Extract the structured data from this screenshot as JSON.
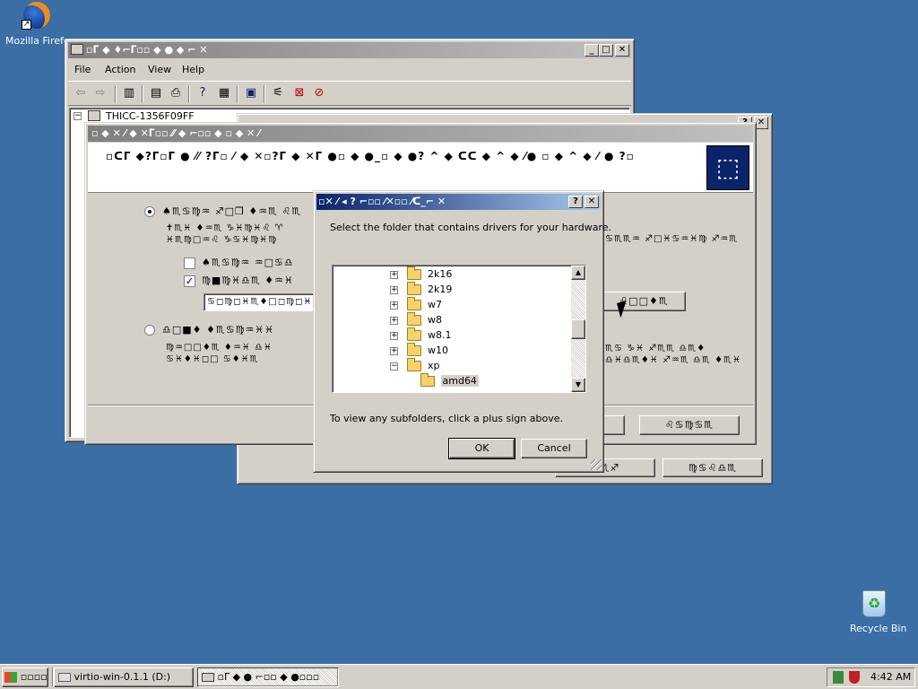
{
  "desktop": {
    "firefox_label": "Mozilla Firefox",
    "recycle_label": "Recycle Bin"
  },
  "device_manager": {
    "title": "▫ᒥ ◆ ♦⌐ᒥ▫▫ ◆ ● ◆ ⌐ ✕",
    "menu": [
      "File",
      "Action",
      "View",
      "Help"
    ],
    "tree_root": "THICC-1356F09FF"
  },
  "wizard": {
    "title": "▫ ◆ ✕ ⁄ ◆ ✕ᒥ▫▫ ⁄⁄ ◆ ⌐▫▫ ◆ ▫ ◆ ✕ ⁄",
    "header_text": "▫ᑕᒥ ◆?ᒥ▫ᒥ ● ⁄⁄ ?ᒥ▫ ⁄ ◆ ✕▫?ᒥ ◆ ✕ᒥ ●▫ ◆ ●_▫ ◆ ●? ^ ◆ ᑕᑕ ◆ ^ ◆ ⁄● ▫ ◆ ^ ◆ ⁄ ● ?▫",
    "option1_label": "♠♏♋♍♒ ♐□❒ ♦♒♏ ♌♏",
    "option1_desc1": "✝♏♓ ♦♒♏ ♑♓♍♓♌ ♈",
    "option1_desc2": "♓♏♍□♒♌ ♑♋♓♍♓♍",
    "checkbox1_label": "♠♏♋♍♒ ♒□♋♎",
    "checkbox2_label": "♍■♍♓♎♏ ♦♒♓",
    "path_value": "♋◻♍◻♓♏♦□◻♍◻♓♏",
    "browse_label": "♌□□♦♏",
    "option2_label": "♎□■♦ ♦♏♋♍♒♓♓",
    "option2_desc1": "♍♒□□♦♏ ♦♒♓ ♎♓",
    "option2_desc2": "♋♓♦♓◻□ ♋♦♓♏",
    "right_text1": "♋♏♏♒ ♐□♓♋♒♓♍ ♐♒♏",
    "right_text2": "♏♋ ♑♓ ♐♏♏ ♎♏♦",
    "right_text3": "♎♓♎♏♦♓ ♐♒♏ ♎♏ ♦♏♓",
    "next_label": "♌♋♍♋♏",
    "back_label": "♑♏♐",
    "cancel_label": "♍♋♌♎♏"
  },
  "dialog": {
    "title": "▫✕ ⁄ ◂ ? ⌐▫▫ ⁄✕▫▫ ⁄ᑕ_⌐ ✕",
    "help_btn": "?",
    "close_btn": "✕",
    "instruction": "Select the folder that contains drivers for your hardware.",
    "folders": [
      "2k16",
      "2k19",
      "w7",
      "w8",
      "w8.1",
      "w10",
      "xp"
    ],
    "selected_folder": "amd64",
    "hint": "To view any subfolders, click a plus sign above.",
    "ok_label": "OK",
    "cancel_label": "Cancel"
  },
  "taskbar": {
    "start_label": "▫▫▫▫",
    "task1_label": "virtio-win-0.1.1 (D:)",
    "task2_label": "▫ᒥ ◆ ● ⌐▫▫ ◆ ●▫▫▫",
    "clock": "4:42 AM"
  }
}
